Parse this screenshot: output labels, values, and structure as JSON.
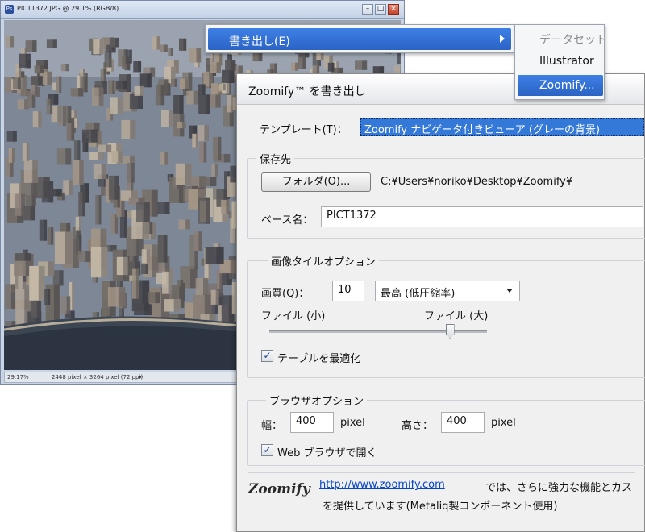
{
  "document": {
    "title": "PICT1372.JPG @ 29.1% (RGB/8)",
    "zoom": "29.17%",
    "info": "2448 pixel × 3264 pixel (72 ppi)",
    "status_arrow": "▸"
  },
  "menus": {
    "export": {
      "label": "書き出し(E)"
    },
    "submenu": [
      {
        "label": "データセット",
        "disabled": true
      },
      {
        "label": "Illustrator",
        "disabled": false
      },
      {
        "label": "Zoomify...",
        "selected": true
      }
    ]
  },
  "dialog": {
    "title": "Zoomify™ を書き出し",
    "template": {
      "label": "テンプレート(T)：",
      "value": "Zoomify ナビゲータ付きビューア (グレーの背景)"
    },
    "destination": {
      "group_label": "保存先",
      "folder_button": "フォルダ(O)...",
      "path": "C:¥Users¥noriko¥Desktop¥Zoomify¥",
      "basename_label": "ベース名：",
      "basename_value": "PICT1372"
    },
    "tile_options": {
      "group_label": "画像タイルオプション",
      "quality_label": "画質(Q)：",
      "quality_value": "10",
      "quality_preset": "最高 (低圧縮率)",
      "slider_min_label": "ファイル (小)",
      "slider_max_label": "ファイル (大)",
      "slider_value_fraction": 0.83,
      "optimize_label": "テーブルを最適化",
      "optimize_checked": true
    },
    "browser_options": {
      "group_label": "ブラウザオプション",
      "width_label": "幅：",
      "width_value": "400",
      "height_label": "高さ：",
      "height_value": "400",
      "unit": "pixel",
      "open_in_browser_label": "Web ブラウザで開く",
      "open_in_browser_checked": true
    },
    "footer": {
      "logo": "Zoomify",
      "link": "http://www.zoomify.com",
      "text_1": "では、さらに強力な機能とカス",
      "text_2": "を提供しています(Metaliq製コンポーネント使用)"
    }
  },
  "colors": {
    "menu_highlight": "#2f6fd6",
    "dialog_bg": "#f0f0f0",
    "link": "#0645c8"
  }
}
